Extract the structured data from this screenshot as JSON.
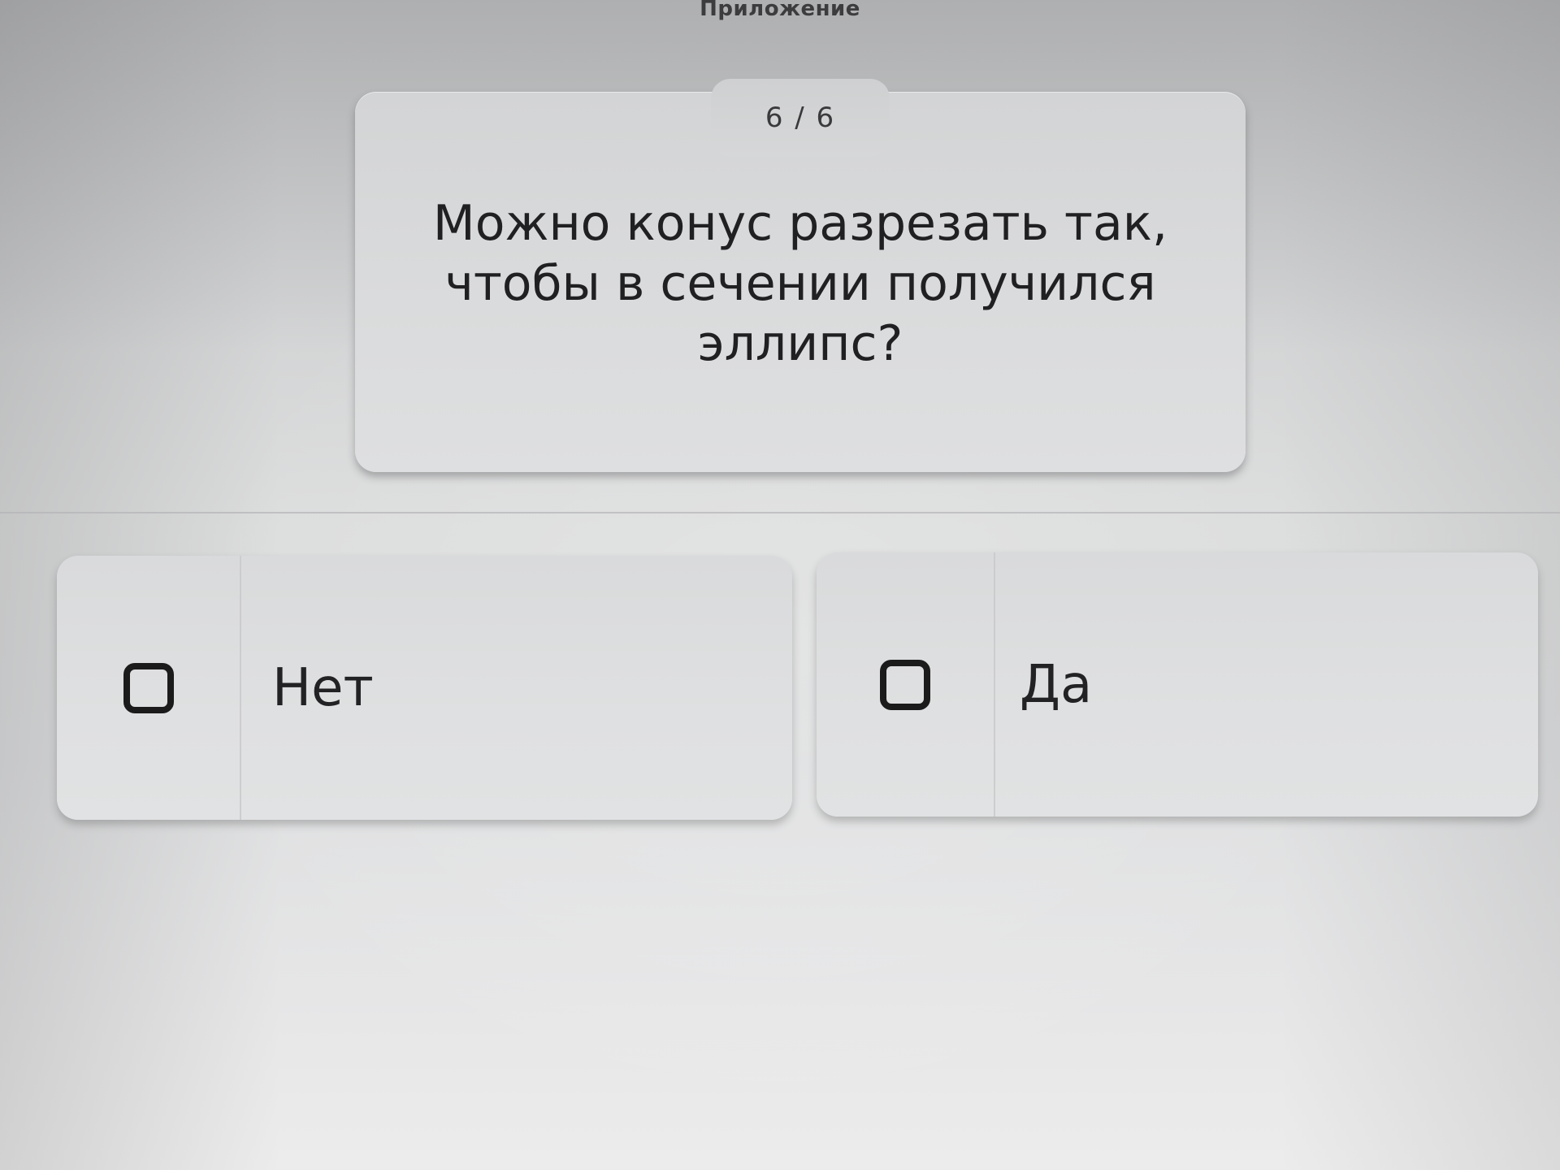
{
  "header": {
    "app_title": "Приложение"
  },
  "question": {
    "counter": "6 / 6",
    "text": "Можно конус разрезать так,\nчтобы в сечении получился\nэллипс?"
  },
  "answers": [
    {
      "label": "Нет",
      "checked": false
    },
    {
      "label": "Да",
      "checked": false
    }
  ],
  "icons": {
    "checkbox": "checkbox-empty-icon"
  }
}
